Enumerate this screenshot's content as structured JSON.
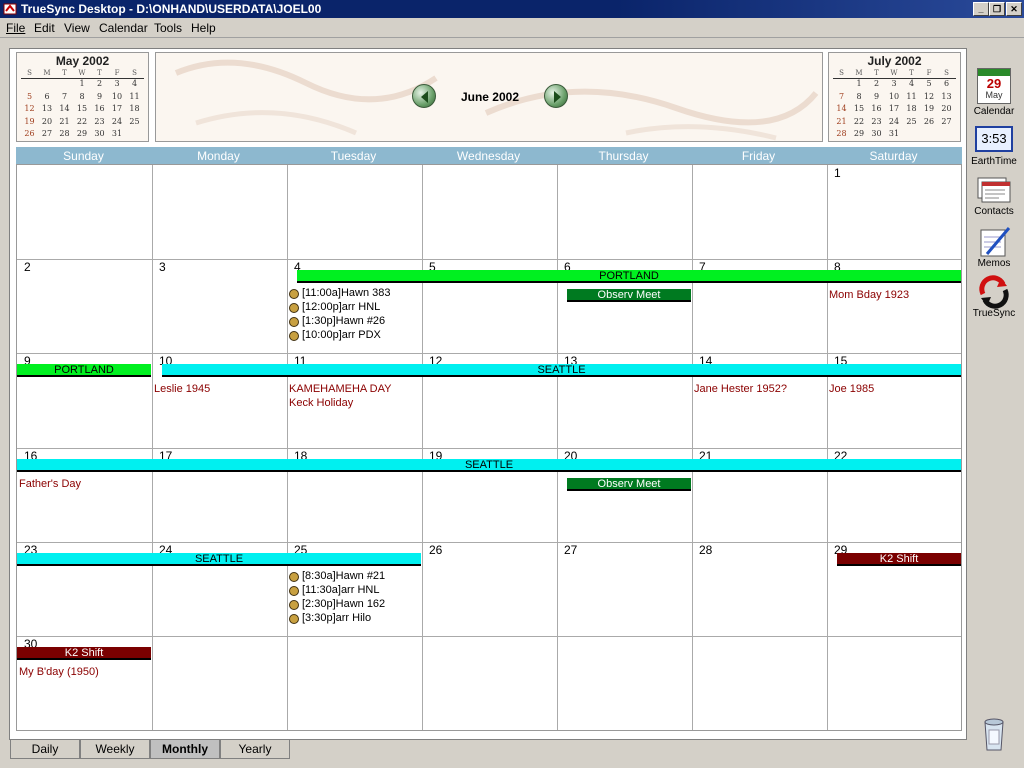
{
  "window": {
    "title": "TrueSync Desktop - D:\\ONHAND\\USERDATA\\JOEL00"
  },
  "menu": [
    {
      "label": "File"
    },
    {
      "label": "Edit"
    },
    {
      "label": "View"
    },
    {
      "label": "Calendar"
    },
    {
      "label": "Tools"
    },
    {
      "label": "Help"
    }
  ],
  "header": {
    "month_title": "June 2002",
    "prev_month": {
      "title": "May 2002",
      "dow": [
        "S",
        "M",
        "T",
        "W",
        "T",
        "F",
        "S"
      ],
      "weeks": [
        [
          "",
          "",
          "",
          "1",
          "2",
          "3",
          "4"
        ],
        [
          "5",
          "6",
          "7",
          "8",
          "9",
          "10",
          "11"
        ],
        [
          "12",
          "13",
          "14",
          "15",
          "16",
          "17",
          "18"
        ],
        [
          "19",
          "20",
          "21",
          "22",
          "23",
          "24",
          "25"
        ],
        [
          "26",
          "27",
          "28",
          "29",
          "30",
          "31",
          ""
        ]
      ]
    },
    "next_month": {
      "title": "July 2002",
      "dow": [
        "S",
        "M",
        "T",
        "W",
        "T",
        "F",
        "S"
      ],
      "weeks": [
        [
          "",
          "1",
          "2",
          "3",
          "4",
          "5",
          "6"
        ],
        [
          "7",
          "8",
          "9",
          "10",
          "11",
          "12",
          "13"
        ],
        [
          "14",
          "15",
          "16",
          "17",
          "18",
          "19",
          "20"
        ],
        [
          "21",
          "22",
          "23",
          "24",
          "25",
          "26",
          "27"
        ],
        [
          "28",
          "29",
          "30",
          "31",
          "",
          "",
          ""
        ]
      ]
    }
  },
  "calendar": {
    "dow": [
      "Sunday",
      "Monday",
      "Tuesday",
      "Wednesday",
      "Thursday",
      "Friday",
      "Saturday"
    ],
    "weeks": [
      [
        "",
        "",
        "",
        "",
        "",
        "",
        "1"
      ],
      [
        "2",
        "3",
        "4",
        "5",
        "6",
        "7",
        "8"
      ],
      [
        "9",
        "10",
        "11",
        "12",
        "13",
        "14",
        "15"
      ],
      [
        "16",
        "17",
        "18",
        "19",
        "20",
        "21",
        "22"
      ],
      [
        "23",
        "24",
        "25",
        "26",
        "27",
        "28",
        "29"
      ],
      [
        "30",
        "",
        "",
        "",
        "",
        "",
        ""
      ]
    ],
    "bars": [
      {
        "week": 1,
        "from": 2,
        "to": 6,
        "label": "PORTLAND",
        "kind": "portland"
      },
      {
        "week": 1,
        "from": 4,
        "to": 4,
        "label": "Observ Meet",
        "kind": "observ"
      },
      {
        "week": 2,
        "from": 0,
        "to": 0,
        "label": "PORTLAND",
        "kind": "portland"
      },
      {
        "week": 2,
        "from": 1,
        "to": 6,
        "label": "SEATTLE",
        "kind": "seattle"
      },
      {
        "week": 3,
        "from": 0,
        "to": 6,
        "label": "SEATTLE",
        "kind": "seattle"
      },
      {
        "week": 3,
        "from": 4,
        "to": 4,
        "label": "Observ Meet",
        "kind": "observ"
      },
      {
        "week": 4,
        "from": 0,
        "to": 2,
        "label": "SEATTLE",
        "kind": "seattle"
      },
      {
        "week": 4,
        "from": 6,
        "to": 6,
        "label": "K2 Shift",
        "kind": "k2"
      },
      {
        "week": 5,
        "from": 0,
        "to": 0,
        "label": "K2 Shift",
        "kind": "k2"
      }
    ],
    "appointments": [
      {
        "week": 1,
        "day": 2,
        "items": [
          "[11:00a]Hawn 383",
          "[12:00p]arr HNL",
          "[1:30p]Hawn #26",
          "[10:00p]arr PDX"
        ]
      },
      {
        "week": 4,
        "day": 2,
        "items": [
          "[8:30a]Hawn #21",
          "[11:30a]arr HNL",
          "[2:30p]Hawn 162",
          "[3:30p]arr Hilo"
        ]
      }
    ],
    "notes": [
      {
        "week": 1,
        "day": 6,
        "items": [
          "Mom Bday 1923"
        ]
      },
      {
        "week": 2,
        "day": 1,
        "items": [
          "Leslie 1945"
        ]
      },
      {
        "week": 2,
        "day": 2,
        "items": [
          "KAMEHAMEHA DAY",
          "Keck Holiday"
        ]
      },
      {
        "week": 2,
        "day": 5,
        "items": [
          "Jane Hester 1952?"
        ]
      },
      {
        "week": 2,
        "day": 6,
        "items": [
          "Joe 1985"
        ]
      },
      {
        "week": 3,
        "day": 0,
        "items": [
          "Father's Day"
        ]
      },
      {
        "week": 5,
        "day": 0,
        "items": [
          "My B'day (1950)"
        ]
      }
    ]
  },
  "sidebar": {
    "calendar": {
      "label": "Calendar",
      "day": "29",
      "month": "May"
    },
    "earthtime": {
      "label": "EarthTime",
      "time": "3:53"
    },
    "contacts": {
      "label": "Contacts"
    },
    "memos": {
      "label": "Memos"
    },
    "truesync": {
      "label": "TrueSync"
    }
  },
  "tabs": [
    {
      "label": "Daily",
      "active": false
    },
    {
      "label": "Weekly",
      "active": false
    },
    {
      "label": "Monthly",
      "active": true
    },
    {
      "label": "Yearly",
      "active": false
    }
  ]
}
